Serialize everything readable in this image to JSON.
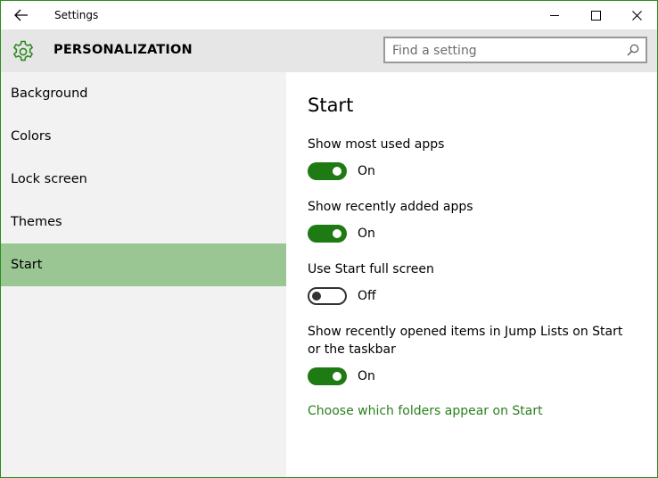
{
  "window": {
    "title": "Settings",
    "accent_color": "#2d8a1f"
  },
  "titlebar": {
    "back_icon": "arrow-left-icon",
    "minimize_icon": "minimize-icon",
    "maximize_icon": "maximize-icon",
    "close_icon": "close-icon"
  },
  "header": {
    "icon": "gear-icon",
    "title": "PERSONALIZATION",
    "search": {
      "placeholder": "Find a setting",
      "value": "",
      "icon": "search-icon"
    }
  },
  "sidebar": {
    "selected_color": "#9ac694",
    "items": [
      {
        "label": "Background",
        "selected": false
      },
      {
        "label": "Colors",
        "selected": false
      },
      {
        "label": "Lock screen",
        "selected": false
      },
      {
        "label": "Themes",
        "selected": false
      },
      {
        "label": "Start",
        "selected": true
      }
    ]
  },
  "content": {
    "heading": "Start",
    "settings": [
      {
        "label": "Show most used apps",
        "state": true,
        "state_label": "On"
      },
      {
        "label": "Show recently added apps",
        "state": true,
        "state_label": "On"
      },
      {
        "label": "Use Start full screen",
        "state": false,
        "state_label": "Off"
      },
      {
        "label": "Show recently opened items in Jump Lists on Start or the taskbar",
        "state": true,
        "state_label": "On"
      }
    ],
    "link": "Choose which folders appear on Start",
    "toggle_on_color": "#1e7a12",
    "link_color": "#2b7f1e"
  }
}
